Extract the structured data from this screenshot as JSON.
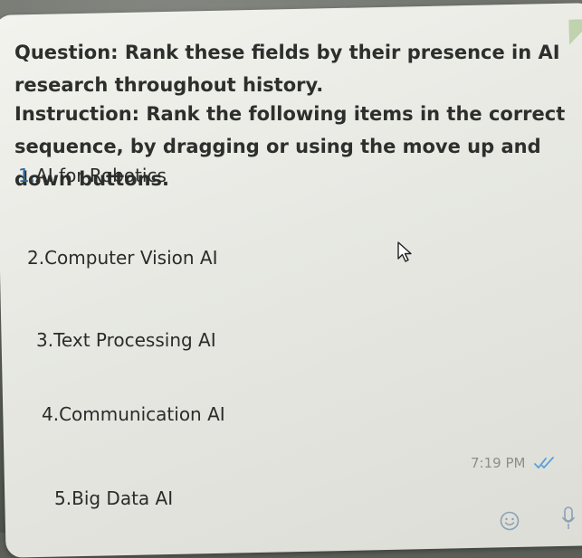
{
  "question": {
    "text": "Question: Rank these fields by their presence in AI research throughout history."
  },
  "instruction": {
    "text": "Instruction: Rank the following items in the correct sequence, by dragging or using the move up and down buttons."
  },
  "items": [
    {
      "number": "1.",
      "label": "AI for Robotics"
    },
    {
      "number": "2.",
      "label": "Computer Vision AI"
    },
    {
      "number": "3.",
      "label": "Text Processing AI"
    },
    {
      "number": "4.",
      "label": "Communication AI"
    },
    {
      "number": "5.",
      "label": "Big Data AI"
    }
  ],
  "message": {
    "time": "7:19 PM",
    "status_icon": "double-check-icon"
  },
  "composer": {
    "emoji_icon": "smiley-icon",
    "mic_icon": "microphone-icon"
  },
  "colors": {
    "bubble": "#ecece7",
    "text": "#2d2f2c",
    "accent_number": "#2f6aa3",
    "timestamp": "#8c8f89",
    "tick": "#5aa0d8"
  }
}
